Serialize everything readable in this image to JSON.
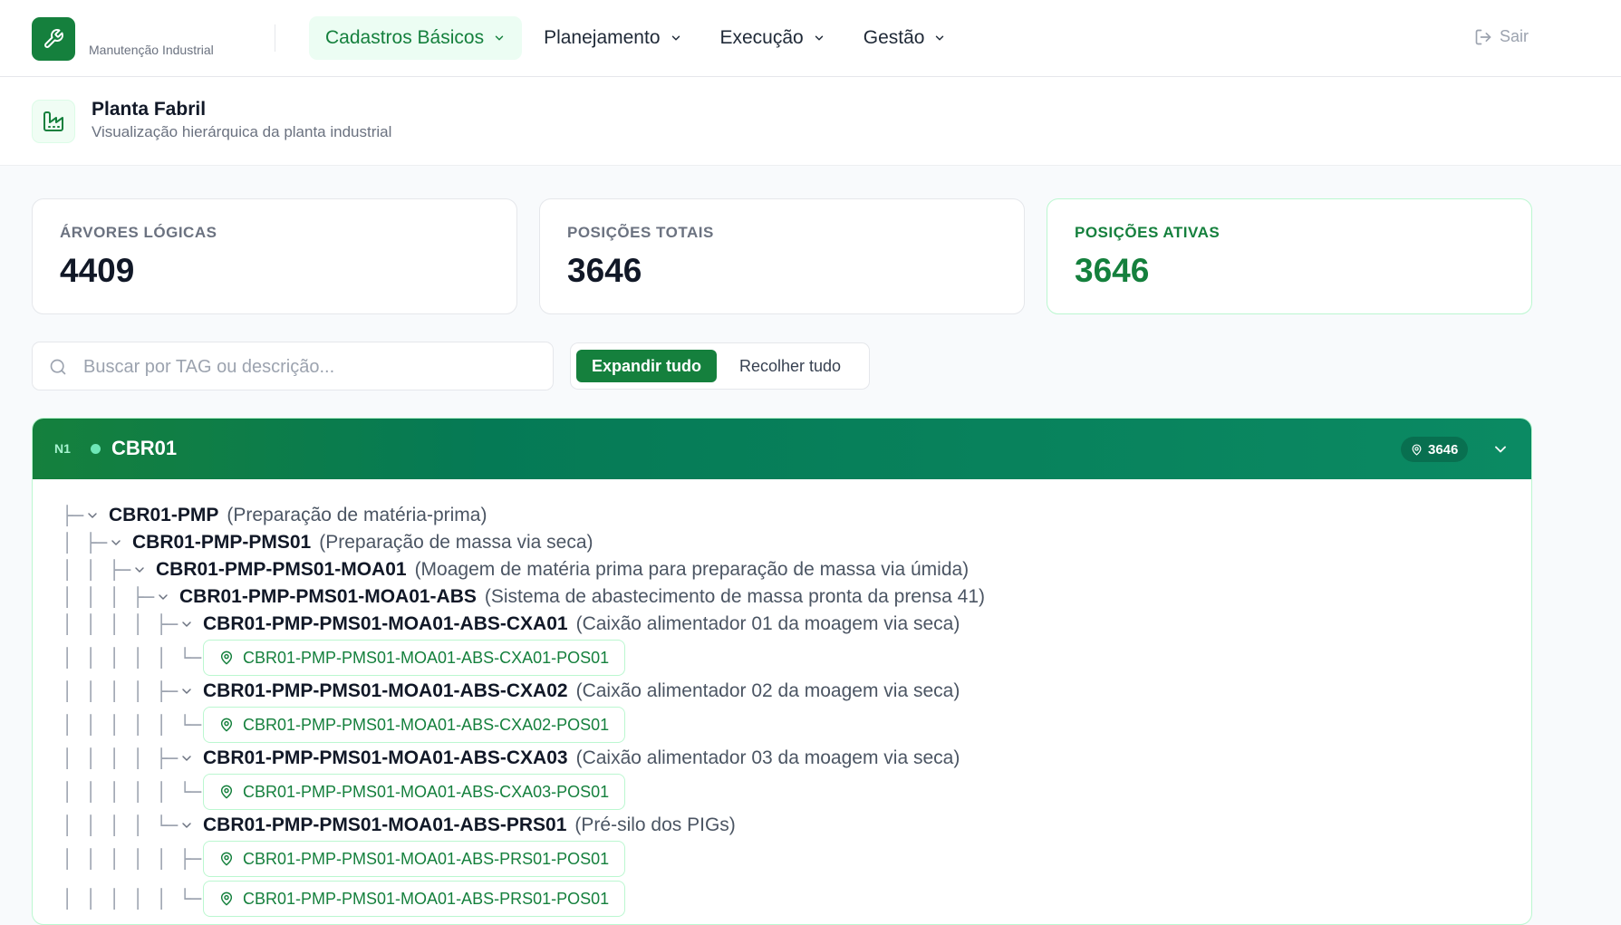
{
  "app": {
    "subtitle": "Manutenção Industrial",
    "accent_color": "#15803d"
  },
  "nav": {
    "items": [
      {
        "label": "Cadastros Básicos",
        "active": true
      },
      {
        "label": "Planejamento",
        "active": false
      },
      {
        "label": "Execução",
        "active": false
      },
      {
        "label": "Gestão",
        "active": false
      }
    ],
    "logout_label": "Sair"
  },
  "page": {
    "title": "Planta Fabril",
    "subtitle": "Visualização hierárquica da planta industrial",
    "icon": "factory-icon"
  },
  "stats": [
    {
      "label": "ÁRVORES LÓGICAS",
      "value": "4409"
    },
    {
      "label": "POSIÇÕES TOTAIS",
      "value": "3646"
    },
    {
      "label": "POSIÇÕES ATIVAS",
      "value": "3646"
    }
  ],
  "search": {
    "placeholder": "Buscar por TAG ou descrição...",
    "value": ""
  },
  "actions": {
    "expand_all": "Expandir tudo",
    "collapse_all": "Recolher tudo"
  },
  "tree": {
    "level_badge": "N1",
    "root_tag": "CBR01",
    "position_count": "3646",
    "rows": [
      {
        "kind": "node",
        "tag": "CBR01-PMP",
        "desc": "(Preparação de matéria-prima)",
        "guides": "├─",
        "indent": 0
      },
      {
        "kind": "node",
        "tag": "CBR01-PMP-PMS01",
        "desc": "(Preparação de massa via seca)",
        "guides": "│├─",
        "indent": 1
      },
      {
        "kind": "node",
        "tag": "CBR01-PMP-PMS01-MOA01",
        "desc": "(Moagem de matéria prima para preparação de massa via úmida)",
        "guides": "││├─",
        "indent": 2
      },
      {
        "kind": "node",
        "tag": "CBR01-PMP-PMS01-MOA01-ABS",
        "desc": "(Sistema de abastecimento de massa pronta da prensa 41)",
        "guides": "│││├─",
        "indent": 3
      },
      {
        "kind": "node",
        "tag": "CBR01-PMP-PMS01-MOA01-ABS-CXA01",
        "desc": "(Caixão alimentador 01 da moagem via seca)",
        "guides": "││││├─",
        "indent": 4
      },
      {
        "kind": "pos",
        "tag": "CBR01-PMP-PMS01-MOA01-ABS-CXA01-POS01",
        "guides": "│││││└─"
      },
      {
        "kind": "node",
        "tag": "CBR01-PMP-PMS01-MOA01-ABS-CXA02",
        "desc": "(Caixão alimentador 02 da moagem via seca)",
        "guides": "││││├─",
        "indent": 4
      },
      {
        "kind": "pos",
        "tag": "CBR01-PMP-PMS01-MOA01-ABS-CXA02-POS01",
        "guides": "│││││└─"
      },
      {
        "kind": "node",
        "tag": "CBR01-PMP-PMS01-MOA01-ABS-CXA03",
        "desc": "(Caixão alimentador 03 da moagem via seca)",
        "guides": "││││├─",
        "indent": 4
      },
      {
        "kind": "pos",
        "tag": "CBR01-PMP-PMS01-MOA01-ABS-CXA03-POS01",
        "guides": "│││││└─"
      },
      {
        "kind": "node",
        "tag": "CBR01-PMP-PMS01-MOA01-ABS-PRS01",
        "desc": "(Pré-silo dos PIGs)",
        "guides": "││││└─",
        "indent": 4
      },
      {
        "kind": "pos",
        "tag": "CBR01-PMP-PMS01-MOA01-ABS-PRS01-POS01",
        "guides": "│││││├─"
      },
      {
        "kind": "pos",
        "tag": "CBR01-PMP-PMS01-MOA01-ABS-PRS01-POS01",
        "guides": "│││││└─"
      }
    ]
  }
}
